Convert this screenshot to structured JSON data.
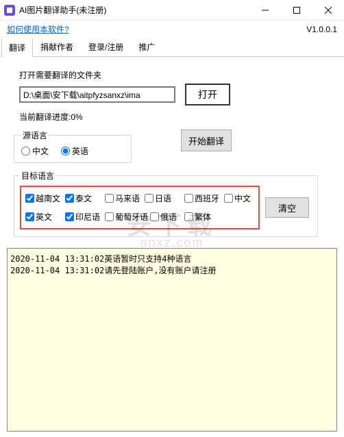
{
  "title": "AI图片翻译助手(未注册)",
  "help_link": "如何使用本软件?",
  "version": "V1.0.0.1",
  "tabs": [
    "翻译",
    "捐献作者",
    "登录/注册",
    "推广"
  ],
  "open_folder_label": "打开需要翻译的文件夹",
  "path_value": "D:\\桌面\\安下载\\aitpfyzsanxz\\ima",
  "open_btn": "打开",
  "progress_label": "当前翻译进度:0%",
  "src_lang_legend": "源语言",
  "src_options": {
    "zh": "中文",
    "en": "英语"
  },
  "start_btn": "开始翻译",
  "target_legend": "目标语言",
  "targets_row1": [
    "越南文",
    "泰文",
    "马来语",
    "日语",
    "西班牙",
    "中文"
  ],
  "targets_row2": [
    "英文",
    "印尼语",
    "葡萄牙语",
    "俄语",
    "繁体"
  ],
  "clear_btn": "清空",
  "log": "2020-11-04 13:31:02英语暂时只支持4种语言\n2020-11-04 13:31:02请先登陆账户,没有账户请注册",
  "watermark": "安下载",
  "watermark_sub": "anxz.com"
}
